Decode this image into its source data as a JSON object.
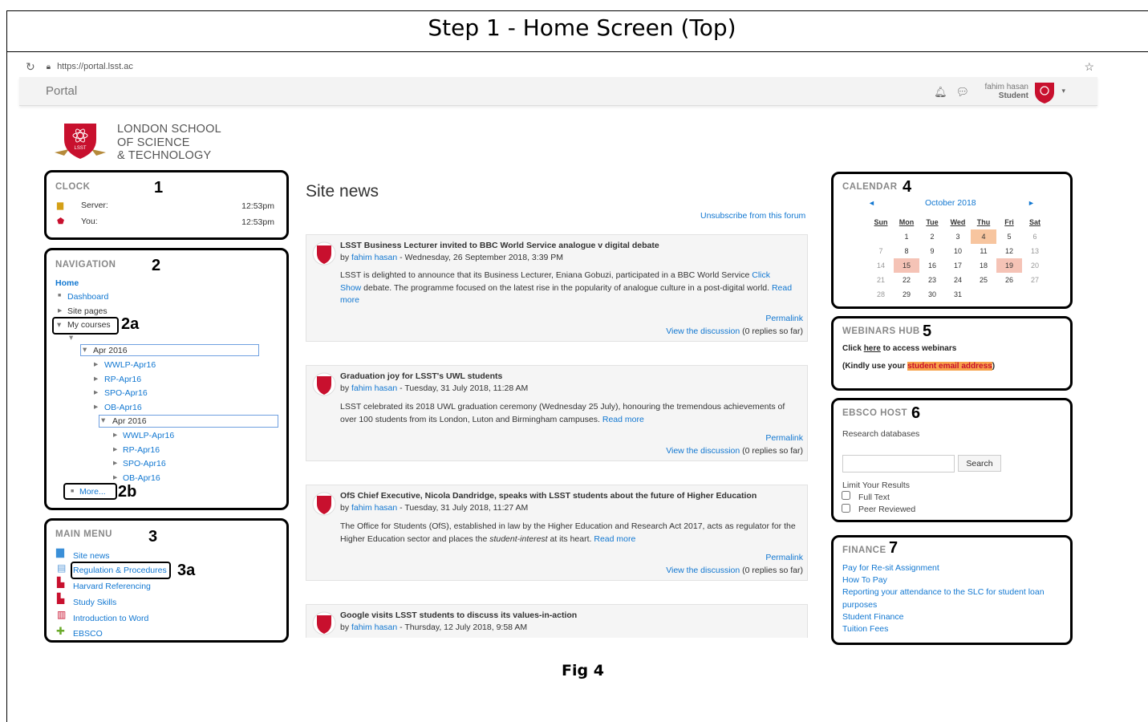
{
  "doc": {
    "title": "Step 1 - Home Screen (Top)",
    "figure": "Fig 4"
  },
  "browser": {
    "url": "https://portal.lsst.ac"
  },
  "navbar": {
    "brand": "Portal",
    "user_name": "fahim hasan",
    "user_role": "Student"
  },
  "logo": {
    "line1": "LONDON SCHOOL",
    "line2": "OF SCIENCE",
    "line3": "& TECHNOLOGY",
    "badge": "LSST"
  },
  "clock": {
    "title": "CLOCK",
    "num": "1",
    "server_label": "Server:",
    "server_time": "12:53pm",
    "you_label": "You:",
    "you_time": "12:53pm"
  },
  "navigation": {
    "title": "NAVIGATION",
    "num": "2",
    "home": "Home",
    "dashboard": "Dashboard",
    "site_pages": "Site pages",
    "my_courses": "My courses",
    "tag_2a": "2a",
    "group1": "Apr 2016",
    "group1_items": [
      "WWLP-Apr16",
      "RP-Apr16",
      "SPO-Apr16",
      "OB-Apr16"
    ],
    "group2": "Apr 2016",
    "group2_items": [
      "WWLP-Apr16",
      "RP-Apr16",
      "SPO-Apr16",
      "OB-Apr16"
    ],
    "more": "More...",
    "tag_2b": "2b"
  },
  "main_menu": {
    "title": "MAIN MENU",
    "num": "3",
    "tag_3a": "3a",
    "items": [
      "Site news",
      "Regulation & Procedures",
      "Harvard Referencing",
      "Study Skills",
      "Introduction to Word",
      "EBSCO"
    ]
  },
  "site_news": {
    "title": "Site news",
    "unsubscribe": "Unsubscribe from this forum",
    "posts": [
      {
        "subject": "LSST Business Lecturer invited to BBC World Service analogue v digital debate",
        "by_prefix": "by ",
        "author": "fahim hasan",
        "date": " - Wednesday, 26 September 2018, 3:39 PM",
        "body1": "LSST is delighted to announce that its Business Lecturer, Eniana Gobuzi, participated in a BBC World Service ",
        "link1": "Click",
        "body2_link": "Show",
        "body2": " debate. The programme focused on the latest rise in the popularity of analogue culture in a post-digital world. ",
        "read": "Read",
        "more": "more",
        "permalink": "Permalink",
        "discussion": "View the discussion",
        "replies": " (0 replies so far)"
      },
      {
        "subject": "Graduation joy for LSST's UWL students",
        "by_prefix": "by ",
        "author": "fahim hasan",
        "date": " - Tuesday, 31 July 2018, 11:28 AM",
        "body1": "LSST celebrated its 2018 UWL graduation ceremony (Wednesday 25 July), honouring the tremendous achievements of",
        "body2": "over 100 students from its London, Luton and Birmingham campuses. ",
        "read_more": "Read more",
        "permalink": "Permalink",
        "discussion": "View the discussion",
        "replies": " (0 replies so far)"
      },
      {
        "subject": "OfS Chief Executive, Nicola Dandridge, speaks with LSST students about the future of Higher Education",
        "by_prefix": "by ",
        "author": "fahim hasan",
        "date": " - Tuesday, 31 July 2018, 11:27 AM",
        "body1": "The Office for Students (OfS), established in law by the Higher Education and Research Act 2017, acts as regulator for the",
        "body2a": "Higher Education sector and places the ",
        "body2_em": "student-interest",
        "body2b": " at its heart. ",
        "read_more": "Read more",
        "permalink": "Permalink",
        "discussion": "View the discussion",
        "replies": " (0 replies so far)"
      },
      {
        "subject": "Google visits LSST students to discuss its values-in-action",
        "by_prefix": "by ",
        "author": "fahim hasan",
        "date": " - Thursday, 12 July 2018, 9:58 AM"
      }
    ]
  },
  "calendar": {
    "title": "CALENDAR",
    "num": "4",
    "month": "October 2018",
    "prev": "◄",
    "next": "►",
    "days": [
      "Sun",
      "Mon",
      "Tue",
      "Wed",
      "Thu",
      "Fri",
      "Sat"
    ],
    "weeks": [
      [
        "",
        "1",
        "2",
        "3",
        "4",
        "5",
        "6"
      ],
      [
        "7",
        "8",
        "9",
        "10",
        "11",
        "12",
        "13"
      ],
      [
        "14",
        "15",
        "16",
        "17",
        "18",
        "19",
        "20"
      ],
      [
        "21",
        "22",
        "23",
        "24",
        "25",
        "26",
        "27"
      ],
      [
        "28",
        "29",
        "30",
        "31",
        "",
        "",
        ""
      ]
    ],
    "event_days": [
      "15",
      "19"
    ],
    "today": "4"
  },
  "webinars": {
    "title": "WEBINARS HUB",
    "num": "5",
    "line1a": "Click ",
    "here": "here",
    "line1b": " to access webinars",
    "line2a": "(Kindly use your ",
    "highlight": "student email address",
    "line2b": ")"
  },
  "ebsco": {
    "title": "EBSCO HOST",
    "num": "6",
    "subtitle": "Research databases",
    "search_button": "Search",
    "limit": "Limit Your Results",
    "full_text": "Full Text",
    "peer": "Peer Reviewed"
  },
  "finance": {
    "title": "FINANCE",
    "num": "7",
    "links": [
      "Pay for Re-sit Assignment",
      "How To Pay",
      "Reporting your attendance to the SLC for student loan",
      "purposes",
      "Student Finance",
      "Tuition Fees"
    ]
  },
  "colors": {
    "link": "#1177d1",
    "accent_red": "#c8102e",
    "highlight": "#f7a24b"
  }
}
